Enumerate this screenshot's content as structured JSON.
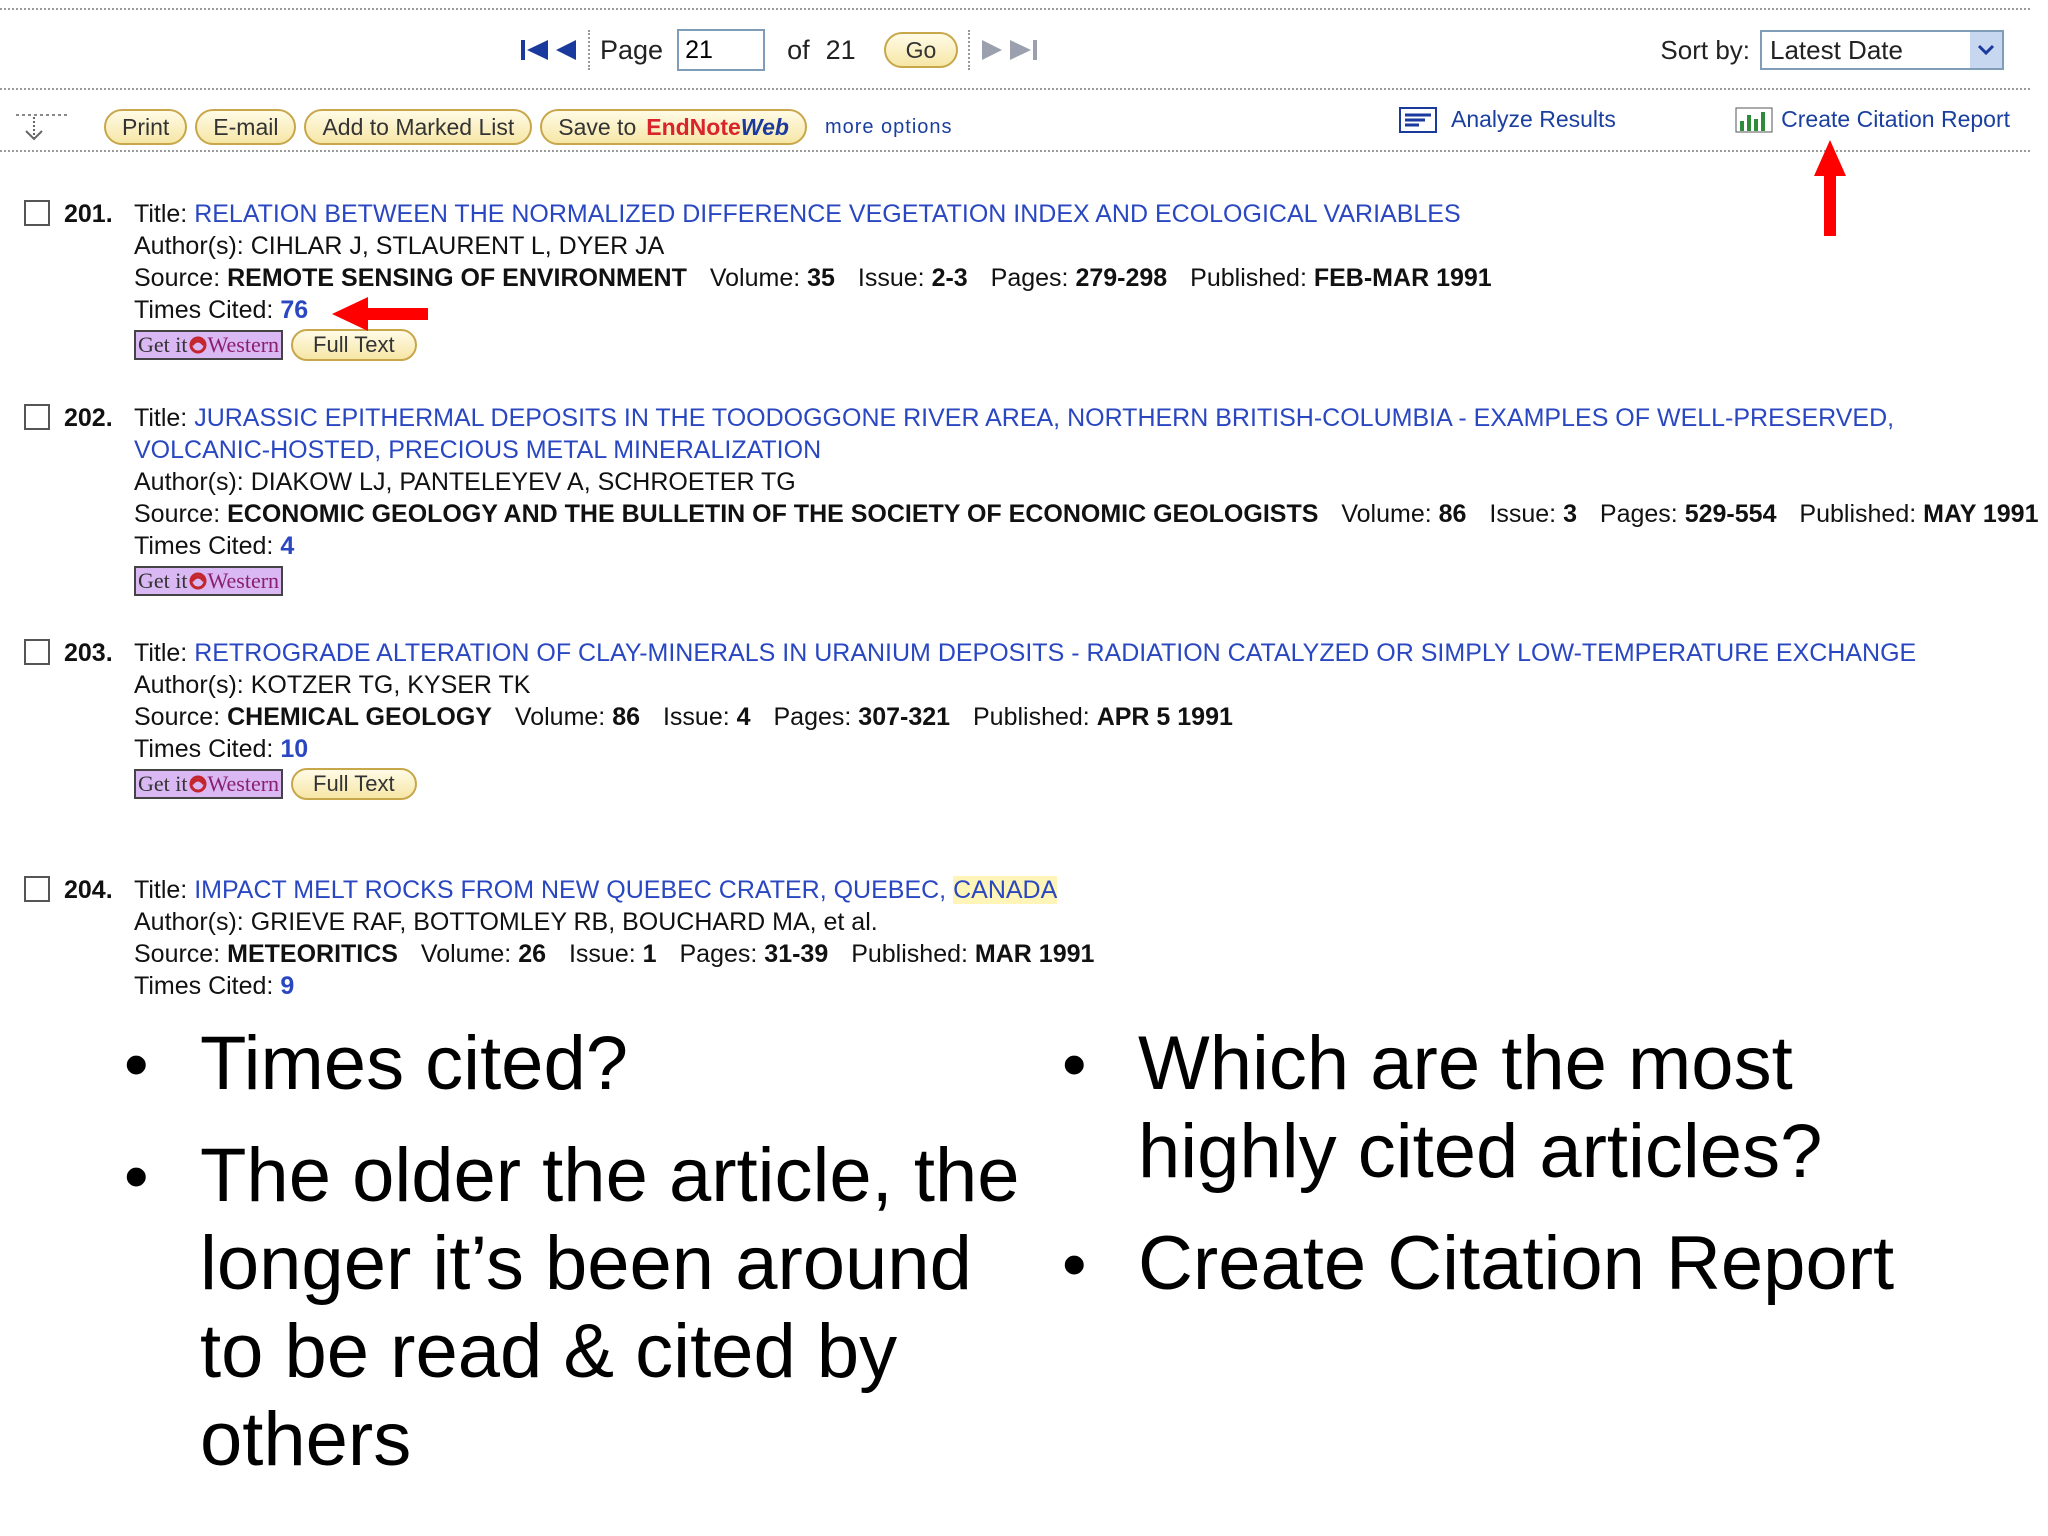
{
  "pager": {
    "page_label": "Page",
    "page_value": "21",
    "of_label": "of",
    "total_pages": "21",
    "go_label": "Go"
  },
  "sort": {
    "label": "Sort by:",
    "selected": "Latest Date"
  },
  "toolbar": {
    "print": "Print",
    "email": "E-mail",
    "add_marked": "Add to Marked List",
    "save_to": "Save to",
    "endnote": "EndNote",
    "web": "Web",
    "more_options": "more options",
    "analyze": "Analyze Results",
    "citation_report": "Create Citation Report"
  },
  "labels": {
    "title": "Title:",
    "authors": "Author(s):",
    "source": "Source:",
    "volume": "Volume:",
    "issue": "Issue:",
    "pages": "Pages:",
    "published": "Published:",
    "times_cited": "Times Cited:",
    "getit_prefix": "Get it",
    "getit_suffix": "Western",
    "full_text": "Full Text"
  },
  "records": [
    {
      "num": "201.",
      "title": "RELATION BETWEEN THE NORMALIZED DIFFERENCE VEGETATION INDEX AND ECOLOGICAL VARIABLES",
      "authors": "CIHLAR J, STLAURENT L, DYER JA",
      "source": "REMOTE SENSING OF ENVIRONMENT",
      "volume": "35",
      "issue": "2-3",
      "pages": "279-298",
      "published": "FEB-MAR 1991",
      "times_cited": "76"
    },
    {
      "num": "202.",
      "title": "JURASSIC EPITHERMAL DEPOSITS IN THE TOODOGGONE RIVER AREA, NORTHERN BRITISH-COLUMBIA - EXAMPLES OF WELL-PRESERVED, VOLCANIC-HOSTED, PRECIOUS METAL MINERALIZATION",
      "authors": "DIAKOW LJ, PANTELEYEV A, SCHROETER TG",
      "source": "ECONOMIC GEOLOGY AND THE BULLETIN OF THE SOCIETY OF ECONOMIC GEOLOGISTS",
      "volume": "86",
      "issue": "3",
      "pages": "529-554",
      "published": "MAY 1991",
      "times_cited": "4"
    },
    {
      "num": "203.",
      "title": "RETROGRADE ALTERATION OF CLAY-MINERALS IN URANIUM DEPOSITS - RADIATION CATALYZED OR SIMPLY LOW-TEMPERATURE EXCHANGE",
      "authors": "KOTZER TG, KYSER TK",
      "source": "CHEMICAL GEOLOGY",
      "volume": "86",
      "issue": "4",
      "pages": "307-321",
      "published": "APR 5 1991",
      "times_cited": "10"
    },
    {
      "num": "204.",
      "title_main": "IMPACT MELT ROCKS FROM NEW QUEBEC CRATER, QUEBEC,",
      "title_hl": "CANADA",
      "authors": "GRIEVE RAF, BOTTOMLEY RB, BOUCHARD MA, et al.",
      "source": "METEORITICS",
      "volume": "26",
      "issue": "1",
      "pages": "31-39",
      "published": "MAR 1991",
      "times_cited": "9"
    }
  ],
  "bullets_left": [
    "Times cited?",
    "The older the article, the longer it’s been around to be read & cited by others"
  ],
  "bullets_right": [
    "Which are the most highly cited articles?",
    "Create Citation Report"
  ],
  "colors": {
    "link": "#2a47c2",
    "arrow": "#ff0000",
    "getit_bg": "#d9b8f3",
    "pill_bg": "#f6e6a6"
  }
}
